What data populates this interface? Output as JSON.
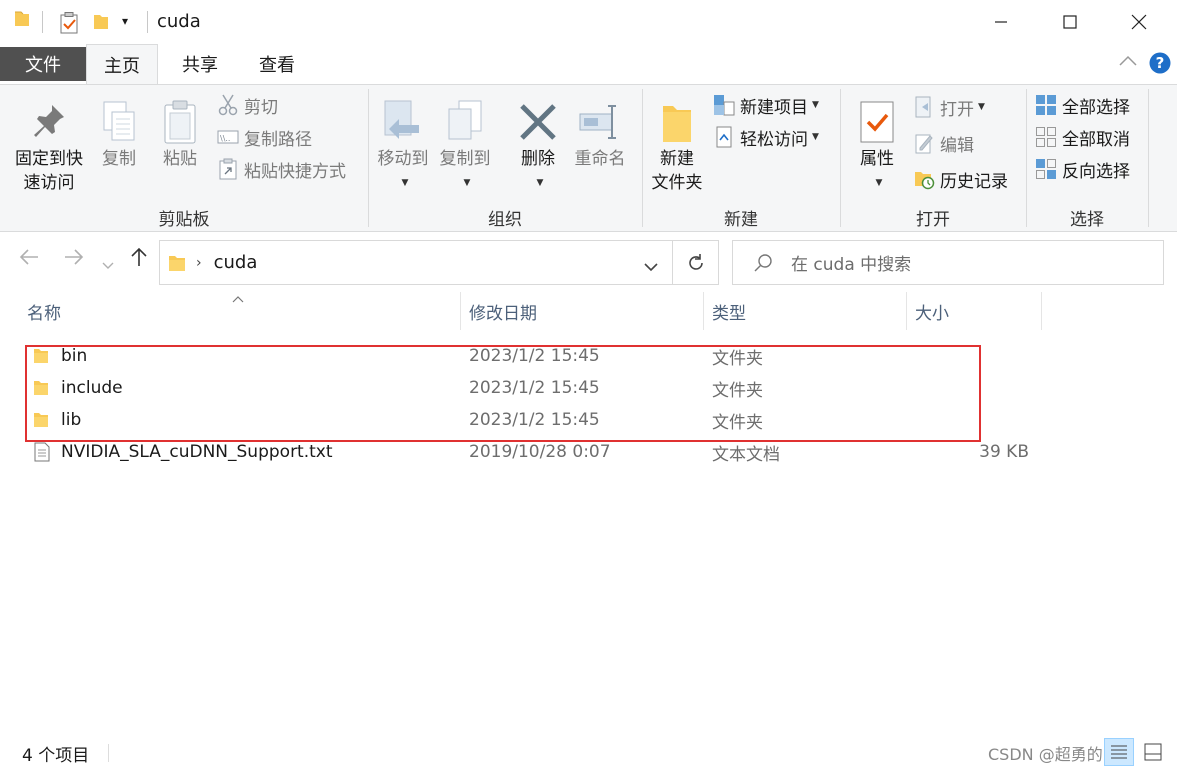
{
  "window": {
    "title": "cuda",
    "minimize": "—",
    "maximize": "☐",
    "close": "✕"
  },
  "tabs": [
    {
      "label": "文件"
    },
    {
      "label": "主页"
    },
    {
      "label": "共享"
    },
    {
      "label": "查看"
    }
  ],
  "ribbon": {
    "clipboard": {
      "label": "剪贴板",
      "pin_line1": "固定到快",
      "pin_line2": "速访问",
      "copy": "复制",
      "paste": "粘贴",
      "cut": "剪切",
      "copy_path": "复制路径",
      "paste_shortcut": "粘贴快捷方式"
    },
    "organize": {
      "label": "组织",
      "move_to": "移动到",
      "copy_to": "复制到",
      "delete": "删除",
      "rename": "重命名"
    },
    "new": {
      "label": "新建",
      "new_folder_line1": "新建",
      "new_folder_line2": "文件夹",
      "new_item": "新建项目",
      "easy_access": "轻松访问"
    },
    "open": {
      "label": "打开",
      "properties": "属性",
      "open": "打开",
      "edit": "编辑",
      "history": "历史记录"
    },
    "select": {
      "label": "选择",
      "select_all": "全部选择",
      "select_none": "全部取消",
      "invert": "反向选择"
    }
  },
  "address": {
    "path": "cuda",
    "search_placeholder": "在 cuda 中搜索"
  },
  "columns": {
    "name": "名称",
    "date": "修改日期",
    "type": "类型",
    "size": "大小"
  },
  "files": [
    {
      "name": "bin",
      "date": "2023/1/2 15:45",
      "type": "文件夹",
      "size": "",
      "kind": "folder"
    },
    {
      "name": "include",
      "date": "2023/1/2 15:45",
      "type": "文件夹",
      "size": "",
      "kind": "folder"
    },
    {
      "name": "lib",
      "date": "2023/1/2 15:45",
      "type": "文件夹",
      "size": "",
      "kind": "folder"
    },
    {
      "name": "NVIDIA_SLA_cuDNN_Support.txt",
      "date": "2019/10/28 0:07",
      "type": "文本文档",
      "size": "39 KB",
      "kind": "text-file"
    }
  ],
  "status": {
    "item_count": "4 个项目",
    "watermark": "CSDN @超勇的阿晶"
  },
  "colors": {
    "highlight_box": "#e03131",
    "folder": "#f8c955",
    "accent_blue": "#1e6ec8"
  }
}
